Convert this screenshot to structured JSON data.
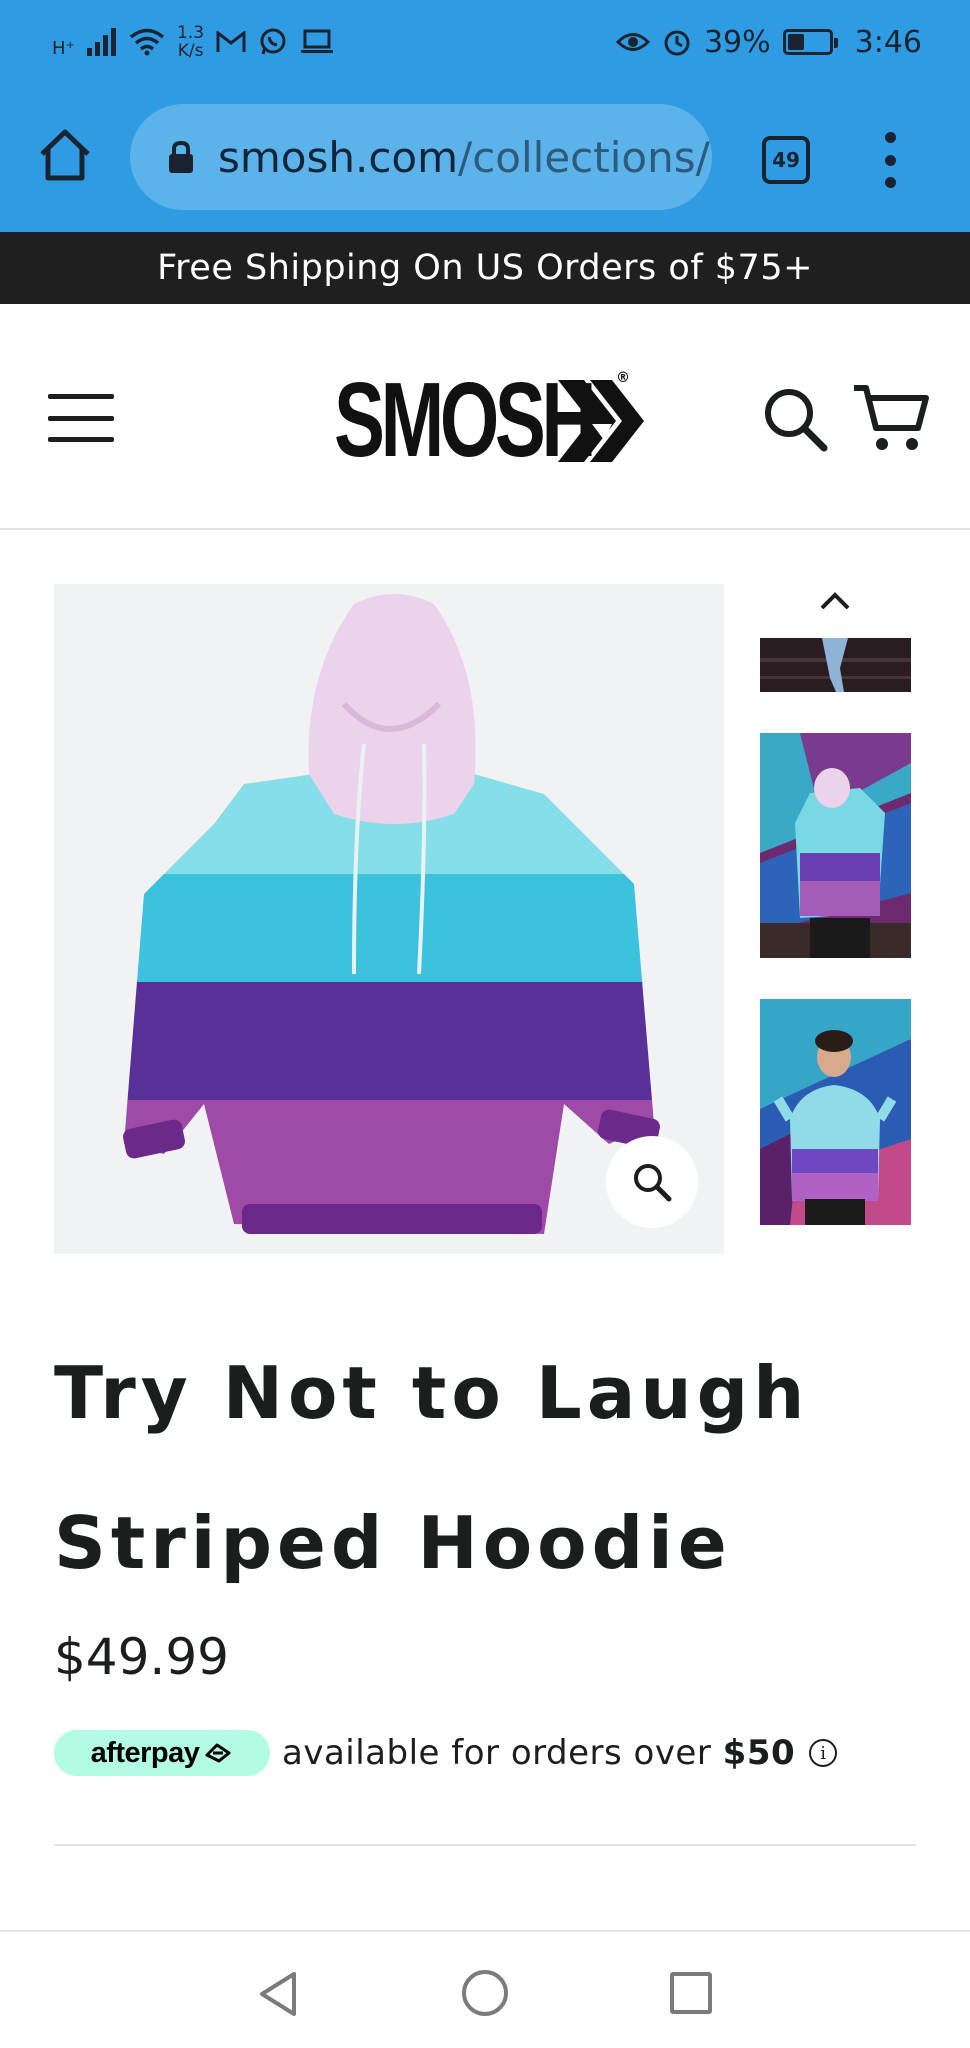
{
  "status_bar": {
    "network": "H⁺",
    "speed_value": "1.3",
    "speed_unit": "K/s",
    "battery_percent": "39%",
    "battery_level": 0.39,
    "time": "3:46",
    "icons": [
      "signal-icon",
      "wifi-icon",
      "gmail-icon",
      "whatsapp-icon",
      "laptop-icon",
      "eye-icon",
      "alarm-icon",
      "battery-icon"
    ]
  },
  "browser": {
    "url_domain": "smosh.com",
    "url_path": "/collections/",
    "tab_count": "49"
  },
  "announcement": "Free Shipping On US Orders of $75+",
  "header": {
    "logo_text": "SMOSH"
  },
  "product": {
    "title_line1": "Try Not to Laugh",
    "title_line2": "Striped Hoodie",
    "price": "$49.99",
    "afterpay": {
      "badge": "afterpay",
      "text": "available for orders over",
      "amount": "$50",
      "info": "i"
    }
  },
  "colors": {
    "browser_blue": "#2f9be2",
    "announcement_bg": "#1f1f1f",
    "afterpay_mint": "#b2fce4",
    "hood_pink": "#ecd3ec",
    "stripe_light_blue": "#86dfe8",
    "stripe_cyan": "#3cc2dc",
    "stripe_purple": "#5a2f9a",
    "stripe_magenta": "#9e4aa6"
  }
}
